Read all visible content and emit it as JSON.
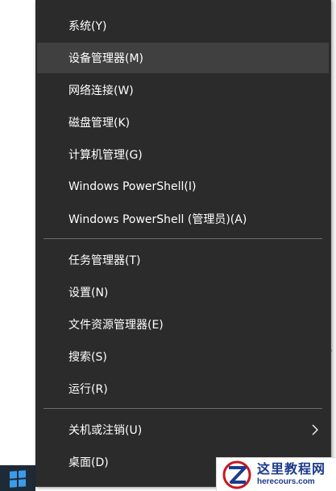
{
  "menu": {
    "items": [
      {
        "label": "系统(Y)"
      },
      {
        "label": "设备管理器(M)"
      },
      {
        "label": "网络连接(W)"
      },
      {
        "label": "磁盘管理(K)"
      },
      {
        "label": "计算机管理(G)"
      },
      {
        "label": "Windows PowerShell(I)"
      },
      {
        "label": "Windows PowerShell (管理员)(A)"
      },
      {
        "label": "任务管理器(T)"
      },
      {
        "label": "设置(N)"
      },
      {
        "label": "文件资源管理器(E)"
      },
      {
        "label": "搜索(S)"
      },
      {
        "label": "运行(R)"
      },
      {
        "label": "关机或注销(U)"
      },
      {
        "label": "桌面(D)"
      }
    ],
    "highlighted_item": "设备管理器(M)",
    "submenu_indicator_icon": "chevron-right-icon"
  },
  "taskbar": {
    "start_icon": "windows-logo-icon"
  },
  "watermark": {
    "title": "这里教程网",
    "domain": "herecours.com",
    "icon": "z-logo-icon"
  },
  "colors": {
    "menu_background": "#2b2b2b",
    "menu_hover": "#404040",
    "menu_text": "#ffffff",
    "separator": "#6b6b6b",
    "taskbar": "#1e2a36",
    "windows_logo": "#3b9bea",
    "watermark_text": "#1c3b8c"
  }
}
